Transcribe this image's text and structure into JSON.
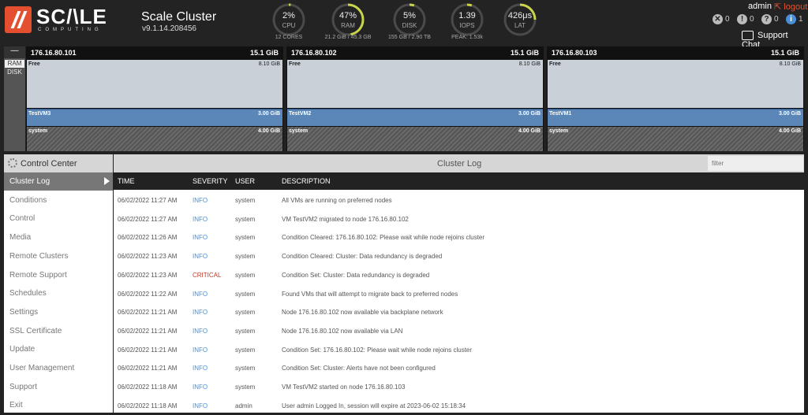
{
  "header": {
    "logo_text": "SC/\\LE",
    "logo_sub": "COMPUTING",
    "cluster_name": "Scale Cluster",
    "version": "v9.1.14.208456",
    "user": "admin",
    "logout_label": "logout",
    "support_label": "Support Chat",
    "alerts": [
      {
        "icon": "x-circle-icon",
        "glyph": "✕",
        "count": "0"
      },
      {
        "icon": "warning-icon",
        "glyph": "!",
        "count": "0"
      },
      {
        "icon": "question-icon",
        "glyph": "?",
        "count": "0"
      },
      {
        "icon": "info-icon",
        "glyph": "i",
        "count": "1"
      }
    ]
  },
  "gauges": [
    {
      "value": "2%",
      "label": "CPU",
      "sub": "12 CORES",
      "fraction": 0.02
    },
    {
      "value": "47%",
      "label": "RAM",
      "sub": "21.2 GiB / 45.3 GB",
      "fraction": 0.47
    },
    {
      "value": "5%",
      "label": "DISK",
      "sub": "155 GB / 2.90 TB",
      "fraction": 0.05
    },
    {
      "value": "1.39",
      "label": "IOPS",
      "sub": "PEAK: 1.53k",
      "fraction": 0.05
    },
    {
      "value": "426μs",
      "label": "LAT",
      "sub": "",
      "fraction": 0.25
    }
  ],
  "toggle": {
    "dash": "—",
    "ram": "RAM",
    "disk": "DISK"
  },
  "nodes": [
    {
      "ip": "176.16.80.101",
      "total": "15.1 GiB",
      "free_label": "Free",
      "free_size": "8.10 GiB",
      "vm_name": "TestVM3",
      "vm_size": "3.00 GiB",
      "system_label": "system",
      "system_size": "4.00 GiB"
    },
    {
      "ip": "176.16.80.102",
      "total": "15.1 GiB",
      "free_label": "Free",
      "free_size": "8.10 GiB",
      "vm_name": "TestVM2",
      "vm_size": "3.00 GiB",
      "system_label": "system",
      "system_size": "4.00 GiB"
    },
    {
      "ip": "176.16.80.103",
      "total": "15.1 GiB",
      "free_label": "Free",
      "free_size": "8.10 GiB",
      "vm_name": "TestVM1",
      "vm_size": "3.00 GiB",
      "system_label": "system",
      "system_size": "4.00 GiB"
    }
  ],
  "sidebar": {
    "title": "Control Center",
    "items": [
      "Cluster Log",
      "Conditions",
      "Control",
      "Media",
      "Remote Clusters",
      "Remote Support",
      "Schedules",
      "Settings",
      "SSL Certificate",
      "Update",
      "User Management",
      "Support",
      "Exit"
    ],
    "active_index": 0
  },
  "log": {
    "title": "Cluster Log",
    "filter_placeholder": "filter",
    "columns": {
      "time": "TIME",
      "severity": "SEVERITY",
      "user": "USER",
      "description": "DESCRIPTION"
    },
    "rows": [
      {
        "time": "06/02/2022 11:27 AM",
        "severity": "INFO",
        "user": "system",
        "description": "All VMs are running on preferred nodes"
      },
      {
        "time": "06/02/2022 11:27 AM",
        "severity": "INFO",
        "user": "system",
        "description": "VM TestVM2 migrated to node 176.16.80.102"
      },
      {
        "time": "06/02/2022 11:26 AM",
        "severity": "INFO",
        "user": "system",
        "description": "Condition Cleared: 176.16.80.102: Please wait while node rejoins cluster"
      },
      {
        "time": "06/02/2022 11:23 AM",
        "severity": "INFO",
        "user": "system",
        "description": "Condition Cleared: Cluster: Data redundancy is degraded"
      },
      {
        "time": "06/02/2022 11:23 AM",
        "severity": "CRITICAL",
        "user": "system",
        "description": "Condition Set: Cluster: Data redundancy is degraded"
      },
      {
        "time": "06/02/2022 11:22 AM",
        "severity": "INFO",
        "user": "system",
        "description": "Found VMs that will attempt to migrate back to preferred nodes"
      },
      {
        "time": "06/02/2022 11:21 AM",
        "severity": "INFO",
        "user": "system",
        "description": "Node 176.16.80.102 now available via backplane network"
      },
      {
        "time": "06/02/2022 11:21 AM",
        "severity": "INFO",
        "user": "system",
        "description": "Node 176.16.80.102 now available via LAN"
      },
      {
        "time": "06/02/2022 11:21 AM",
        "severity": "INFO",
        "user": "system",
        "description": "Condition Set: 176.16.80.102: Please wait while node rejoins cluster"
      },
      {
        "time": "06/02/2022 11:21 AM",
        "severity": "INFO",
        "user": "system",
        "description": "Condition Set: Cluster: Alerts have not been configured"
      },
      {
        "time": "06/02/2022 11:18 AM",
        "severity": "INFO",
        "user": "system",
        "description": "VM TestVM2 started on node 176.16.80.103"
      },
      {
        "time": "06/02/2022 11:18 AM",
        "severity": "INFO",
        "user": "admin",
        "description": "User admin Logged In, session will expire at 2023-06-02 15:18:34"
      }
    ]
  },
  "colors": {
    "accent": "#e4502f",
    "info": "#4a90d9",
    "critical": "#c0392b",
    "gauge_arc": "#c8d44a"
  }
}
